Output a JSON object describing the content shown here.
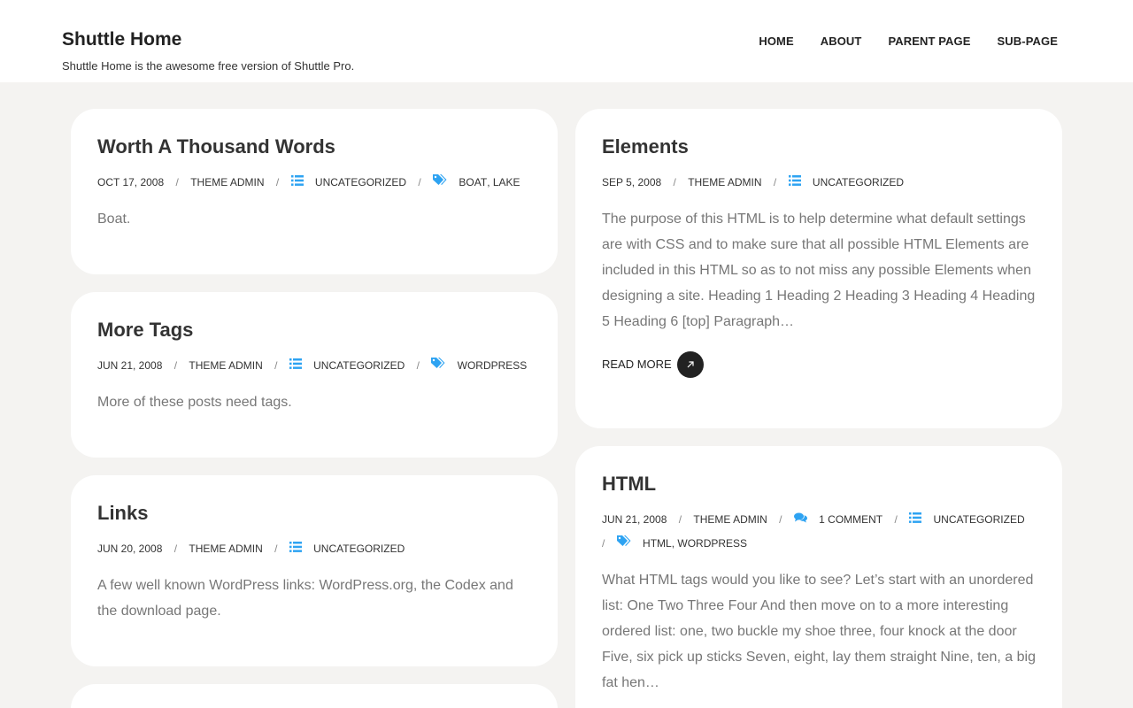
{
  "site": {
    "title": "Shuttle Home",
    "description": "Shuttle Home is the awesome free version of Shuttle Pro."
  },
  "nav": [
    {
      "label": "HOME"
    },
    {
      "label": "ABOUT"
    },
    {
      "label": "PARENT PAGE"
    },
    {
      "label": "SUB-PAGE"
    }
  ],
  "colors": {
    "accent": "#2ea3f2",
    "background": "#f4f3f1",
    "card": "#ffffff"
  },
  "separator": "/",
  "posts": [
    {
      "title": "Worth A Thousand Words",
      "date": "OCT 17, 2008",
      "author": "THEME ADMIN",
      "category": "UNCATEGORIZED",
      "tags": [
        "BOAT",
        "LAKE"
      ],
      "excerpt": "Boat."
    },
    {
      "title": "More Tags",
      "date": "JUN 21, 2008",
      "author": "THEME ADMIN",
      "category": "UNCATEGORIZED",
      "tags": [
        "WORDPRESS"
      ],
      "excerpt": "More of these posts need tags."
    },
    {
      "title": "Links",
      "date": "JUN 20, 2008",
      "author": "THEME ADMIN",
      "category": "UNCATEGORIZED",
      "excerpt": "A few well known WordPress links: WordPress.org, the Codex and the download page."
    },
    {
      "title": "Elements",
      "date": "SEP 5, 2008",
      "author": "THEME ADMIN",
      "category": "UNCATEGORIZED",
      "excerpt": "The purpose of this HTML is to help determine what default settings are with CSS and to make sure that all possible HTML Elements are included in this HTML so as to not miss any possible Elements when designing a site. Heading 1 Heading 2 Heading 3 Heading 4 Heading 5 Heading 6 [top] Paragraph…",
      "read_more": "READ MORE"
    },
    {
      "title": "HTML",
      "date": "JUN 21, 2008",
      "author": "THEME ADMIN",
      "comments": "1 COMMENT",
      "category": "UNCATEGORIZED",
      "tags": [
        "HTML",
        "WORDPRESS"
      ],
      "excerpt": "What HTML tags would you like to see? Let’s start with an unordered list: One Two Three Four And then move on to a more interesting ordered list: one, two buckle my shoe three, four knock at the door Five, six pick up sticks Seven, eight, lay them straight Nine, ten, a big fat hen…"
    }
  ],
  "icons": {
    "category": "list-icon",
    "tags": "tags-icon",
    "comments": "comments-icon",
    "read_more": "arrow-up-right-icon"
  }
}
